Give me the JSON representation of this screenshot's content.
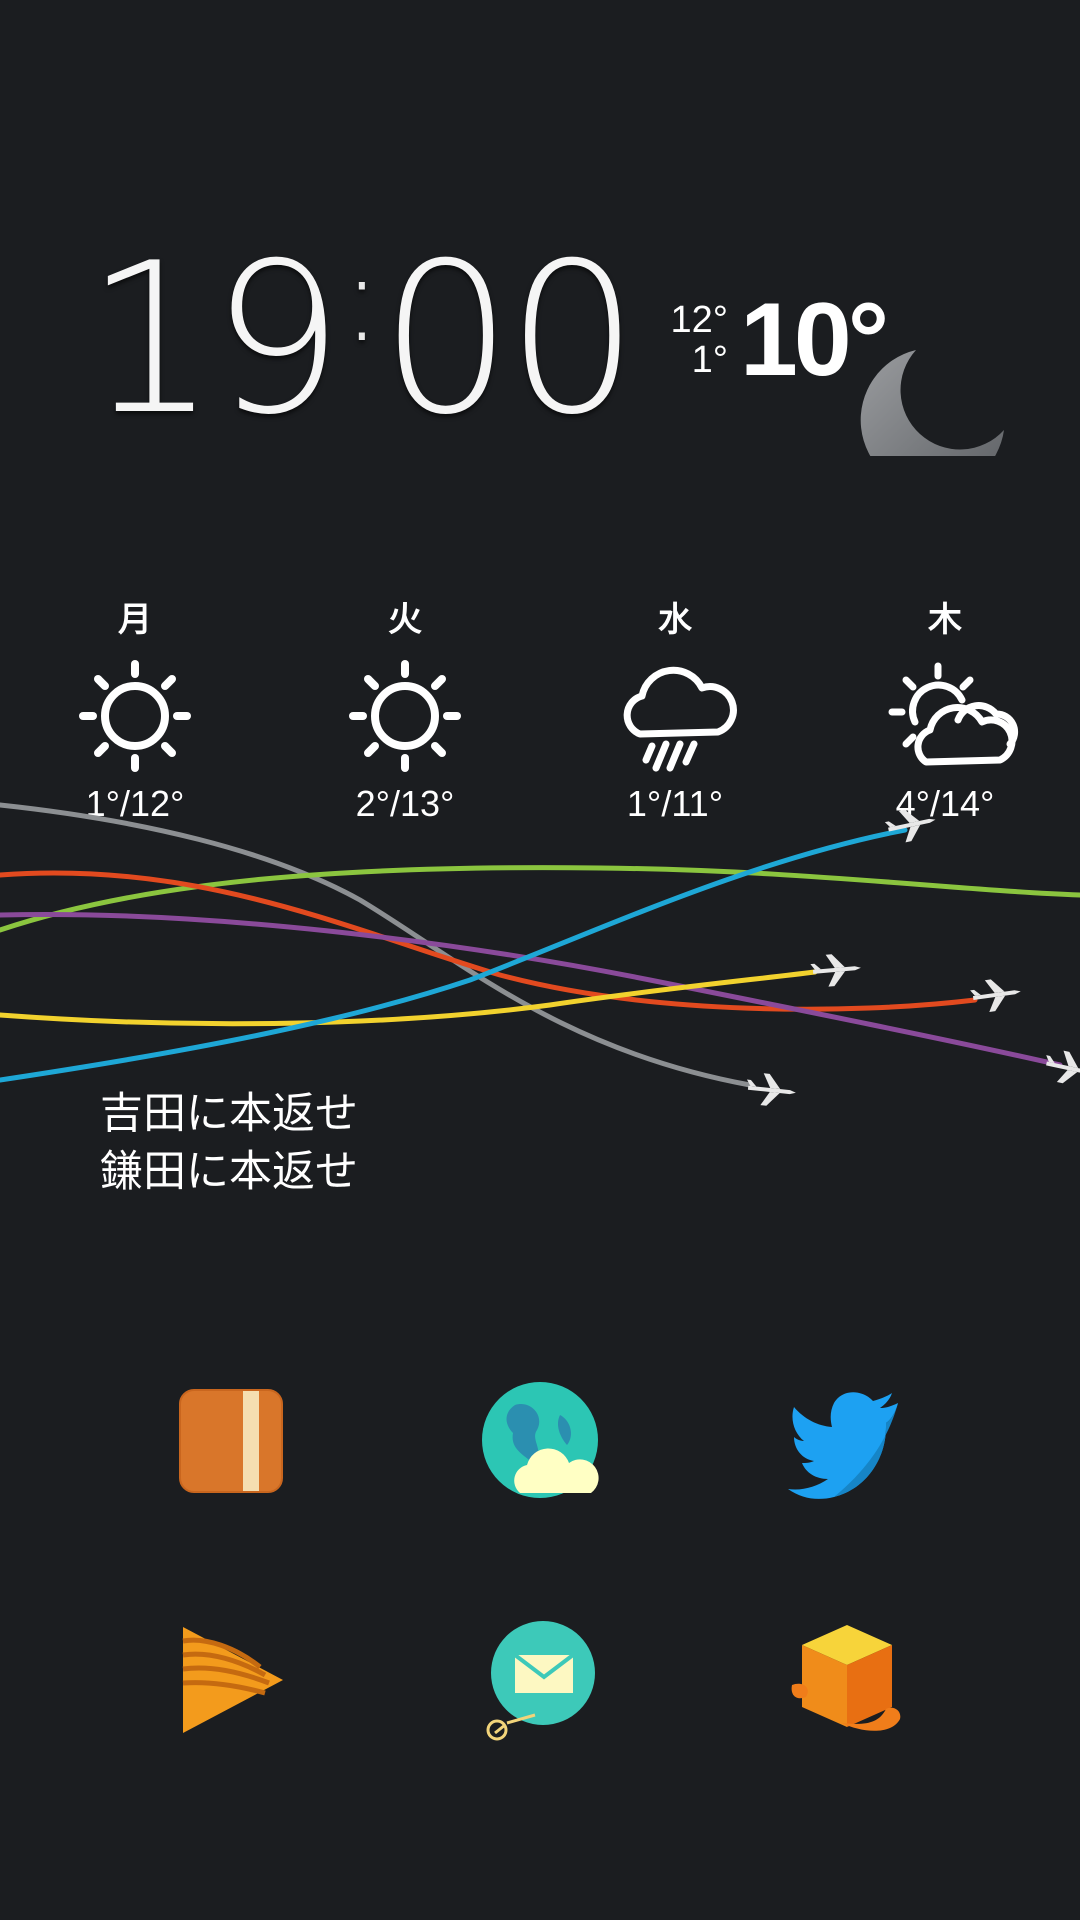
{
  "clock": {
    "hour": "19",
    "minute": "00"
  },
  "weather_now": {
    "high": "12°",
    "low": "1°",
    "current": "10°",
    "icon": "crescent-moon-icon"
  },
  "forecast": [
    {
      "day": "月",
      "range": "1°/12°",
      "icon": "sun-icon"
    },
    {
      "day": "火",
      "range": "2°/13°",
      "icon": "sun-icon"
    },
    {
      "day": "水",
      "range": "1°/11°",
      "icon": "rain-cloud-icon"
    },
    {
      "day": "木",
      "range": "4°/14°",
      "icon": "partly-cloudy-icon"
    }
  ],
  "notes": {
    "line1": "吉田に本返せ",
    "line2": "鎌田に本返せ"
  },
  "flight_colors": [
    "#8c8f92",
    "#e24a1f",
    "#8bc53f",
    "#8a4a9a",
    "#1ea7d6",
    "#f2d22e"
  ],
  "apps": [
    {
      "icon": "notebook-app-icon",
      "color": "#d9762a"
    },
    {
      "icon": "globe-weather-app-icon",
      "color": "#2cc6b4"
    },
    {
      "icon": "twitter-bird-icon",
      "color": "#1da1f2"
    },
    {
      "icon": "play-media-app-icon",
      "color": "#f39b1c"
    },
    {
      "icon": "mail-balloon-app-icon",
      "color": "#3dc9b9"
    },
    {
      "icon": "box-package-app-icon",
      "color": "#f07d1a"
    }
  ]
}
